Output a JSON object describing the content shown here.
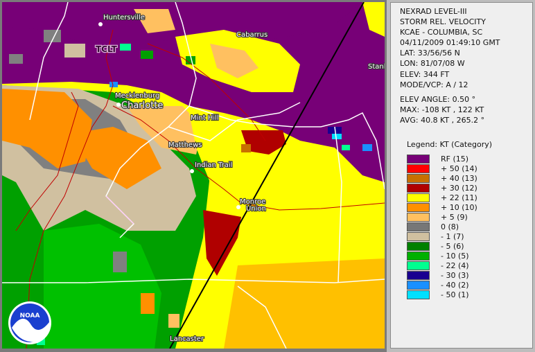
{
  "header": {
    "lines": [
      "NEXRAD LEVEL-III",
      "STORM REL. VELOCITY",
      "KCAE - COLUMBIA, SC",
      "04/11/2009 01:49:10 GMT",
      "LAT: 33/56/56 N",
      "LON: 81/07/08 W",
      "ELEV: 344 FT",
      "MODE/VCP: A / 12"
    ],
    "scan_lines": [
      "ELEV ANGLE: 0.50 °",
      "MAX: -108 KT , 122 KT",
      "AVG: 40.8 KT , 265.2 °"
    ]
  },
  "legend": {
    "title": "Legend: KT (Category)",
    "items": [
      {
        "label": "RF  (15)",
        "color": "#770077"
      },
      {
        "label": "+ 50  (14)",
        "color": "#ff0000"
      },
      {
        "label": "+ 40  (13)",
        "color": "#c87000"
      },
      {
        "label": "+ 30  (12)",
        "color": "#b00000"
      },
      {
        "label": "+ 22  (11)",
        "color": "#ffff00"
      },
      {
        "label": "+ 10  (10)",
        "color": "#ff9000"
      },
      {
        "label": "+ 5  (9)",
        "color": "#ffc060"
      },
      {
        "label": "0  (8)",
        "color": "#777777"
      },
      {
        "label": "- 1  (7)",
        "color": "#d0c0a0"
      },
      {
        "label": "- 5  (6)",
        "color": "#008000"
      },
      {
        "label": "- 10  (5)",
        "color": "#00b000"
      },
      {
        "label": "- 22  (4)",
        "color": "#00ff90"
      },
      {
        "label": "- 30  (3)",
        "color": "#1a0090"
      },
      {
        "label": "- 40  (2)",
        "color": "#1a90ff"
      },
      {
        "label": "- 50  (1)",
        "color": "#00e0ff"
      }
    ]
  },
  "map": {
    "cities": {
      "huntersville": "Huntersville",
      "cabarrus": "Cabarrus",
      "tclt": "TCLT",
      "stanly": "Stanl",
      "mecklenburg": "Mecklenburg",
      "charlotte": "Charlotte",
      "mint_hill": "Mint Hill",
      "matthews": "Matthews",
      "indian_trail": "Indian Trail",
      "monroe": "Monroe",
      "union": "Union",
      "lancaster": "Lancaster"
    },
    "logo_text": "NOAA"
  }
}
